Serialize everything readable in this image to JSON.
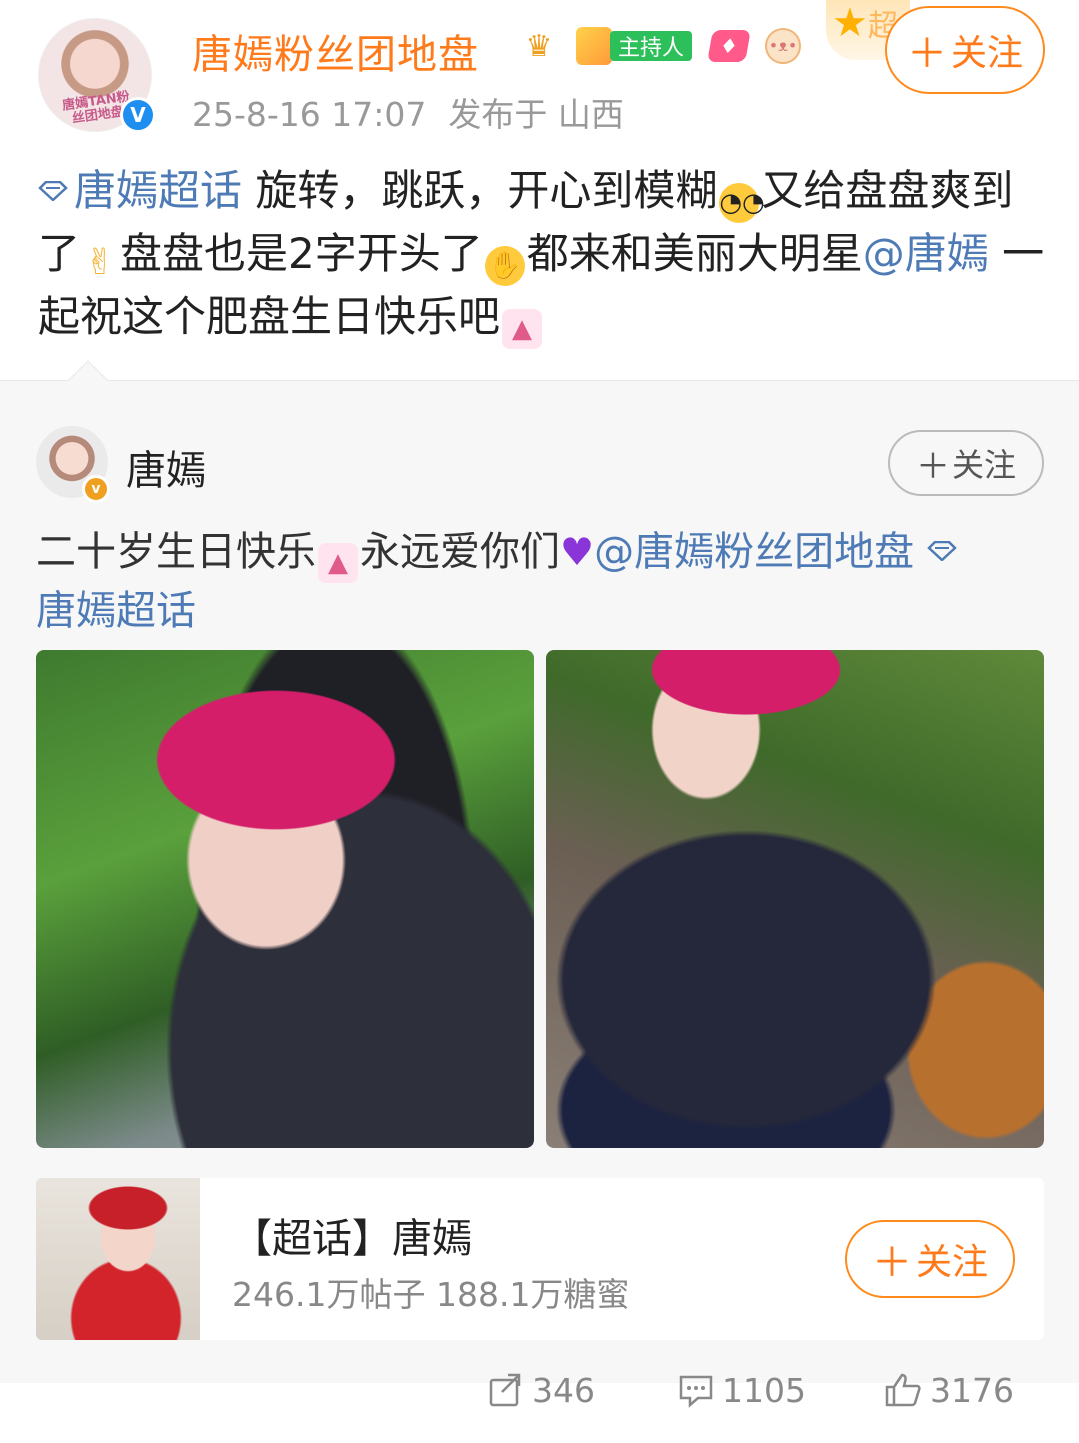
{
  "post": {
    "author": "唐嫣粉丝团地盘",
    "avatar_text": "唐嫣TAN粉丝团地盘",
    "badge_host": "主持人",
    "deco_char": "超",
    "time": "25-8-16 17:07",
    "location": "发布于 山西",
    "follow_label": "关注",
    "plus": "＋",
    "verified_mark": "V",
    "text": {
      "topic": "唐嫣超话",
      "seg1": " 旋转，跳跃，开心到模糊",
      "seg2": "又给盘盘爽到了",
      "seg3": "盘盘也是2字开头了",
      "seg4": "都来和美丽大明星",
      "mention": "@唐嫣",
      "seg5": " 一起祝这个肥盘生日快乐吧"
    }
  },
  "repost": {
    "author": "唐嫣",
    "verified_mark": "v",
    "follow_label": "关注",
    "plus": "＋",
    "text": {
      "seg1": "二十岁生日快乐",
      "seg2": "永远爱你们",
      "mention": "@唐嫣粉丝团地盘",
      "topic": "唐嫣超话"
    },
    "topic_card": {
      "title": "【超话】唐嫣",
      "stats": "246.1万帖子 188.1万糖蜜",
      "follow_label": "关注",
      "plus": "＋"
    }
  },
  "actions": {
    "repost_count": "346",
    "comment_count": "1105",
    "like_count": "3176"
  },
  "colors": {
    "accent": "#ff7a1a",
    "link": "#4e7bb5",
    "meta": "#999999",
    "verified": "#1e8ff0",
    "host_badge": "#2dbf5a"
  },
  "icons": [
    "verified-icon",
    "crown-icon",
    "host-badge-icon",
    "gem-badge-icon",
    "pig-badge-icon",
    "star-deco-icon",
    "diamond-topic-icon",
    "nerd-emoji",
    "victory-emoji",
    "peek-emoji",
    "cake-emoji",
    "purple-heart-emoji",
    "repost-icon",
    "comment-icon",
    "like-icon"
  ]
}
